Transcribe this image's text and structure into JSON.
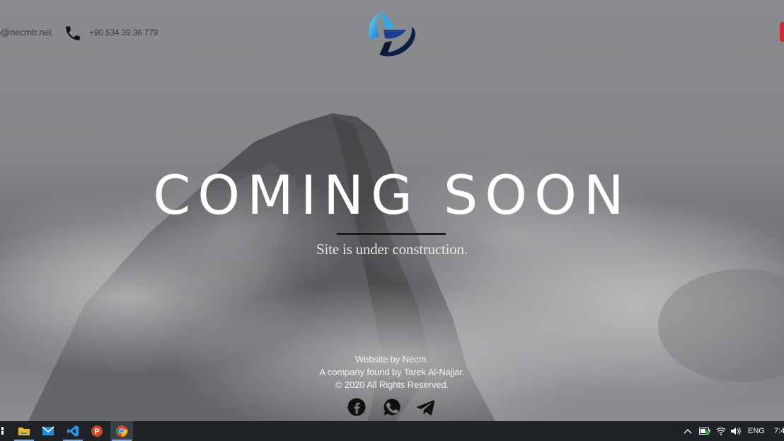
{
  "header": {
    "email": "o@necmtr.net",
    "phone": "+90 534 39 36 779",
    "logo_icon": "necm-logo"
  },
  "hero": {
    "title": "COMING SOON",
    "subtitle": "Site is under construction."
  },
  "footer": {
    "credit": "Website by Necm.",
    "company": "A company found by Tarek Al-Najjar.",
    "copyright": "© 2020 All Rights Reserved.",
    "social": [
      "facebook-icon",
      "whatsapp-icon",
      "telegram-icon"
    ]
  },
  "taskbar": {
    "apps": [
      "file-explorer-icon",
      "mail-icon",
      "vscode-icon",
      "powerpoint-icon",
      "chrome-icon"
    ],
    "active_app": "chrome-icon",
    "language": "ENG",
    "clock": "7:4"
  },
  "colors": {
    "accent_red": "#d12a34",
    "taskbar": "#1f2226",
    "text_white": "#ffffff"
  }
}
